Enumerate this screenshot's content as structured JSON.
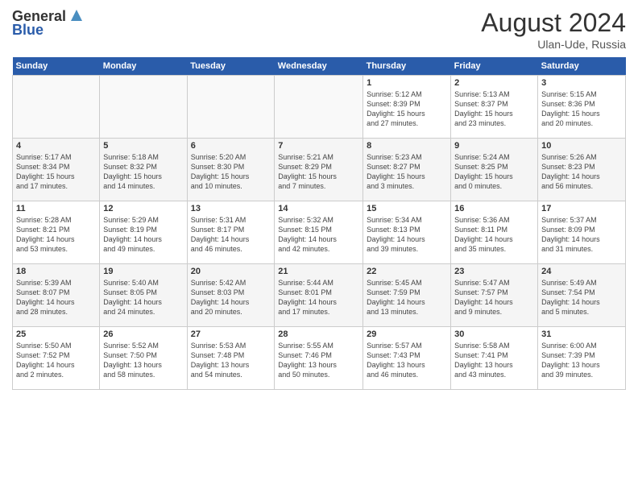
{
  "header": {
    "logo_line1": "General",
    "logo_line2": "Blue",
    "month": "August 2024",
    "location": "Ulan-Ude, Russia"
  },
  "days_of_week": [
    "Sunday",
    "Monday",
    "Tuesday",
    "Wednesday",
    "Thursday",
    "Friday",
    "Saturday"
  ],
  "weeks": [
    [
      {
        "day": "",
        "detail": ""
      },
      {
        "day": "",
        "detail": ""
      },
      {
        "day": "",
        "detail": ""
      },
      {
        "day": "",
        "detail": ""
      },
      {
        "day": "1",
        "detail": "Sunrise: 5:12 AM\nSunset: 8:39 PM\nDaylight: 15 hours\nand 27 minutes."
      },
      {
        "day": "2",
        "detail": "Sunrise: 5:13 AM\nSunset: 8:37 PM\nDaylight: 15 hours\nand 23 minutes."
      },
      {
        "day": "3",
        "detail": "Sunrise: 5:15 AM\nSunset: 8:36 PM\nDaylight: 15 hours\nand 20 minutes."
      }
    ],
    [
      {
        "day": "4",
        "detail": "Sunrise: 5:17 AM\nSunset: 8:34 PM\nDaylight: 15 hours\nand 17 minutes."
      },
      {
        "day": "5",
        "detail": "Sunrise: 5:18 AM\nSunset: 8:32 PM\nDaylight: 15 hours\nand 14 minutes."
      },
      {
        "day": "6",
        "detail": "Sunrise: 5:20 AM\nSunset: 8:30 PM\nDaylight: 15 hours\nand 10 minutes."
      },
      {
        "day": "7",
        "detail": "Sunrise: 5:21 AM\nSunset: 8:29 PM\nDaylight: 15 hours\nand 7 minutes."
      },
      {
        "day": "8",
        "detail": "Sunrise: 5:23 AM\nSunset: 8:27 PM\nDaylight: 15 hours\nand 3 minutes."
      },
      {
        "day": "9",
        "detail": "Sunrise: 5:24 AM\nSunset: 8:25 PM\nDaylight: 15 hours\nand 0 minutes."
      },
      {
        "day": "10",
        "detail": "Sunrise: 5:26 AM\nSunset: 8:23 PM\nDaylight: 14 hours\nand 56 minutes."
      }
    ],
    [
      {
        "day": "11",
        "detail": "Sunrise: 5:28 AM\nSunset: 8:21 PM\nDaylight: 14 hours\nand 53 minutes."
      },
      {
        "day": "12",
        "detail": "Sunrise: 5:29 AM\nSunset: 8:19 PM\nDaylight: 14 hours\nand 49 minutes."
      },
      {
        "day": "13",
        "detail": "Sunrise: 5:31 AM\nSunset: 8:17 PM\nDaylight: 14 hours\nand 46 minutes."
      },
      {
        "day": "14",
        "detail": "Sunrise: 5:32 AM\nSunset: 8:15 PM\nDaylight: 14 hours\nand 42 minutes."
      },
      {
        "day": "15",
        "detail": "Sunrise: 5:34 AM\nSunset: 8:13 PM\nDaylight: 14 hours\nand 39 minutes."
      },
      {
        "day": "16",
        "detail": "Sunrise: 5:36 AM\nSunset: 8:11 PM\nDaylight: 14 hours\nand 35 minutes."
      },
      {
        "day": "17",
        "detail": "Sunrise: 5:37 AM\nSunset: 8:09 PM\nDaylight: 14 hours\nand 31 minutes."
      }
    ],
    [
      {
        "day": "18",
        "detail": "Sunrise: 5:39 AM\nSunset: 8:07 PM\nDaylight: 14 hours\nand 28 minutes."
      },
      {
        "day": "19",
        "detail": "Sunrise: 5:40 AM\nSunset: 8:05 PM\nDaylight: 14 hours\nand 24 minutes."
      },
      {
        "day": "20",
        "detail": "Sunrise: 5:42 AM\nSunset: 8:03 PM\nDaylight: 14 hours\nand 20 minutes."
      },
      {
        "day": "21",
        "detail": "Sunrise: 5:44 AM\nSunset: 8:01 PM\nDaylight: 14 hours\nand 17 minutes."
      },
      {
        "day": "22",
        "detail": "Sunrise: 5:45 AM\nSunset: 7:59 PM\nDaylight: 14 hours\nand 13 minutes."
      },
      {
        "day": "23",
        "detail": "Sunrise: 5:47 AM\nSunset: 7:57 PM\nDaylight: 14 hours\nand 9 minutes."
      },
      {
        "day": "24",
        "detail": "Sunrise: 5:49 AM\nSunset: 7:54 PM\nDaylight: 14 hours\nand 5 minutes."
      }
    ],
    [
      {
        "day": "25",
        "detail": "Sunrise: 5:50 AM\nSunset: 7:52 PM\nDaylight: 14 hours\nand 2 minutes."
      },
      {
        "day": "26",
        "detail": "Sunrise: 5:52 AM\nSunset: 7:50 PM\nDaylight: 13 hours\nand 58 minutes."
      },
      {
        "day": "27",
        "detail": "Sunrise: 5:53 AM\nSunset: 7:48 PM\nDaylight: 13 hours\nand 54 minutes."
      },
      {
        "day": "28",
        "detail": "Sunrise: 5:55 AM\nSunset: 7:46 PM\nDaylight: 13 hours\nand 50 minutes."
      },
      {
        "day": "29",
        "detail": "Sunrise: 5:57 AM\nSunset: 7:43 PM\nDaylight: 13 hours\nand 46 minutes."
      },
      {
        "day": "30",
        "detail": "Sunrise: 5:58 AM\nSunset: 7:41 PM\nDaylight: 13 hours\nand 43 minutes."
      },
      {
        "day": "31",
        "detail": "Sunrise: 6:00 AM\nSunset: 7:39 PM\nDaylight: 13 hours\nand 39 minutes."
      }
    ]
  ]
}
